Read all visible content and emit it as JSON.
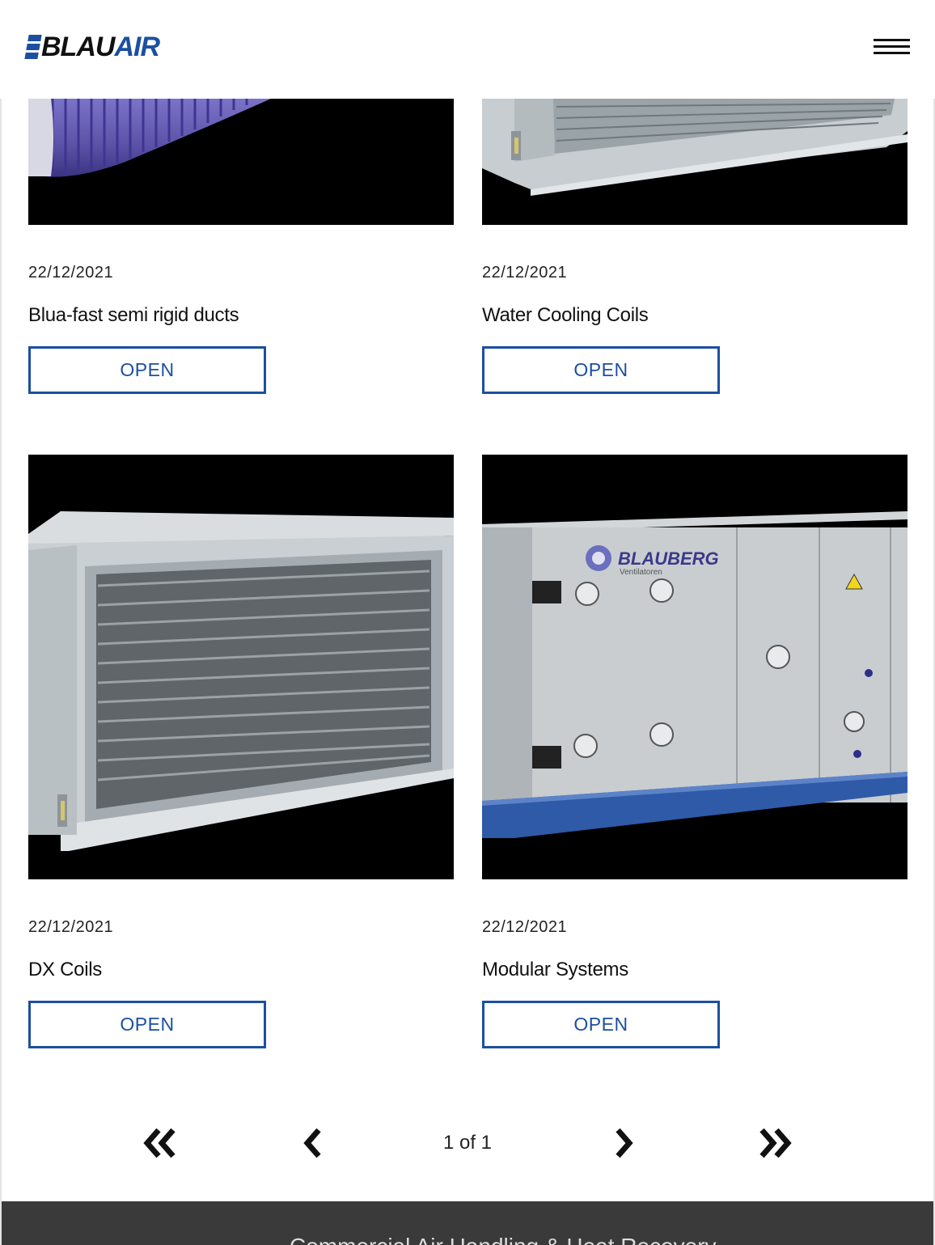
{
  "header": {
    "logo_left": "BLAU",
    "logo_right": "AIR",
    "brand_color": "#1c4fa0"
  },
  "cards": [
    {
      "date": "22/12/2021",
      "title": "Blua-fast semi rigid ducts",
      "button": "OPEN"
    },
    {
      "date": "22/12/2021",
      "title": "Water Cooling Coils",
      "button": "OPEN"
    },
    {
      "date": "22/12/2021",
      "title": "DX Coils",
      "button": "OPEN"
    },
    {
      "date": "22/12/2021",
      "title": "Modular Systems",
      "button": "OPEN"
    }
  ],
  "images": {
    "unit_brand": "BLAUBERG",
    "unit_sub": "Ventilatoren"
  },
  "pagination": {
    "page_info": "1 of 1"
  },
  "footer": {
    "text": "Commercial Air Handling & Heat Recovery"
  },
  "icons": {
    "menu": "hamburger-menu-icon",
    "first": "double-chevron-left-icon",
    "prev": "chevron-left-icon",
    "next": "chevron-right-icon",
    "last": "double-chevron-right-icon"
  }
}
